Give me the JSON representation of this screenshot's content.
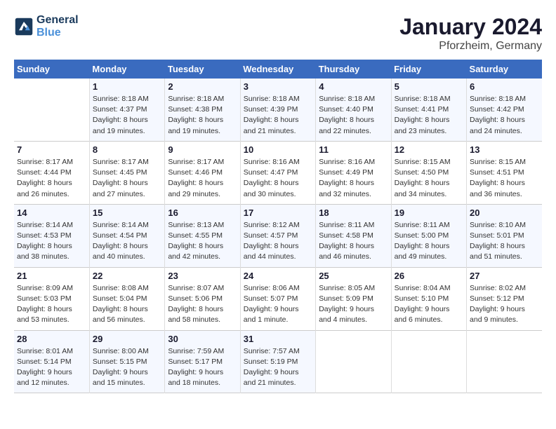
{
  "header": {
    "logo_line1": "General",
    "logo_line2": "Blue",
    "month": "January 2024",
    "location": "Pforzheim, Germany"
  },
  "days_of_week": [
    "Sunday",
    "Monday",
    "Tuesday",
    "Wednesday",
    "Thursday",
    "Friday",
    "Saturday"
  ],
  "weeks": [
    [
      {
        "day": "",
        "empty": true
      },
      {
        "day": "1",
        "sunrise": "8:18 AM",
        "sunset": "4:37 PM",
        "daylight": "8 hours and 19 minutes."
      },
      {
        "day": "2",
        "sunrise": "8:18 AM",
        "sunset": "4:38 PM",
        "daylight": "8 hours and 19 minutes."
      },
      {
        "day": "3",
        "sunrise": "8:18 AM",
        "sunset": "4:39 PM",
        "daylight": "8 hours and 21 minutes."
      },
      {
        "day": "4",
        "sunrise": "8:18 AM",
        "sunset": "4:40 PM",
        "daylight": "8 hours and 22 minutes."
      },
      {
        "day": "5",
        "sunrise": "8:18 AM",
        "sunset": "4:41 PM",
        "daylight": "8 hours and 23 minutes."
      },
      {
        "day": "6",
        "sunrise": "8:18 AM",
        "sunset": "4:42 PM",
        "daylight": "8 hours and 24 minutes."
      }
    ],
    [
      {
        "day": "7",
        "sunrise": "8:17 AM",
        "sunset": "4:44 PM",
        "daylight": "8 hours and 26 minutes."
      },
      {
        "day": "8",
        "sunrise": "8:17 AM",
        "sunset": "4:45 PM",
        "daylight": "8 hours and 27 minutes."
      },
      {
        "day": "9",
        "sunrise": "8:17 AM",
        "sunset": "4:46 PM",
        "daylight": "8 hours and 29 minutes."
      },
      {
        "day": "10",
        "sunrise": "8:16 AM",
        "sunset": "4:47 PM",
        "daylight": "8 hours and 30 minutes."
      },
      {
        "day": "11",
        "sunrise": "8:16 AM",
        "sunset": "4:49 PM",
        "daylight": "8 hours and 32 minutes."
      },
      {
        "day": "12",
        "sunrise": "8:15 AM",
        "sunset": "4:50 PM",
        "daylight": "8 hours and 34 minutes."
      },
      {
        "day": "13",
        "sunrise": "8:15 AM",
        "sunset": "4:51 PM",
        "daylight": "8 hours and 36 minutes."
      }
    ],
    [
      {
        "day": "14",
        "sunrise": "8:14 AM",
        "sunset": "4:53 PM",
        "daylight": "8 hours and 38 minutes."
      },
      {
        "day": "15",
        "sunrise": "8:14 AM",
        "sunset": "4:54 PM",
        "daylight": "8 hours and 40 minutes."
      },
      {
        "day": "16",
        "sunrise": "8:13 AM",
        "sunset": "4:55 PM",
        "daylight": "8 hours and 42 minutes."
      },
      {
        "day": "17",
        "sunrise": "8:12 AM",
        "sunset": "4:57 PM",
        "daylight": "8 hours and 44 minutes."
      },
      {
        "day": "18",
        "sunrise": "8:11 AM",
        "sunset": "4:58 PM",
        "daylight": "8 hours and 46 minutes."
      },
      {
        "day": "19",
        "sunrise": "8:11 AM",
        "sunset": "5:00 PM",
        "daylight": "8 hours and 49 minutes."
      },
      {
        "day": "20",
        "sunrise": "8:10 AM",
        "sunset": "5:01 PM",
        "daylight": "8 hours and 51 minutes."
      }
    ],
    [
      {
        "day": "21",
        "sunrise": "8:09 AM",
        "sunset": "5:03 PM",
        "daylight": "8 hours and 53 minutes."
      },
      {
        "day": "22",
        "sunrise": "8:08 AM",
        "sunset": "5:04 PM",
        "daylight": "8 hours and 56 minutes."
      },
      {
        "day": "23",
        "sunrise": "8:07 AM",
        "sunset": "5:06 PM",
        "daylight": "8 hours and 58 minutes."
      },
      {
        "day": "24",
        "sunrise": "8:06 AM",
        "sunset": "5:07 PM",
        "daylight": "9 hours and 1 minute."
      },
      {
        "day": "25",
        "sunrise": "8:05 AM",
        "sunset": "5:09 PM",
        "daylight": "9 hours and 4 minutes."
      },
      {
        "day": "26",
        "sunrise": "8:04 AM",
        "sunset": "5:10 PM",
        "daylight": "9 hours and 6 minutes."
      },
      {
        "day": "27",
        "sunrise": "8:02 AM",
        "sunset": "5:12 PM",
        "daylight": "9 hours and 9 minutes."
      }
    ],
    [
      {
        "day": "28",
        "sunrise": "8:01 AM",
        "sunset": "5:14 PM",
        "daylight": "9 hours and 12 minutes."
      },
      {
        "day": "29",
        "sunrise": "8:00 AM",
        "sunset": "5:15 PM",
        "daylight": "9 hours and 15 minutes."
      },
      {
        "day": "30",
        "sunrise": "7:59 AM",
        "sunset": "5:17 PM",
        "daylight": "9 hours and 18 minutes."
      },
      {
        "day": "31",
        "sunrise": "7:57 AM",
        "sunset": "5:19 PM",
        "daylight": "9 hours and 21 minutes."
      },
      {
        "day": "",
        "empty": true
      },
      {
        "day": "",
        "empty": true
      },
      {
        "day": "",
        "empty": true
      }
    ]
  ]
}
